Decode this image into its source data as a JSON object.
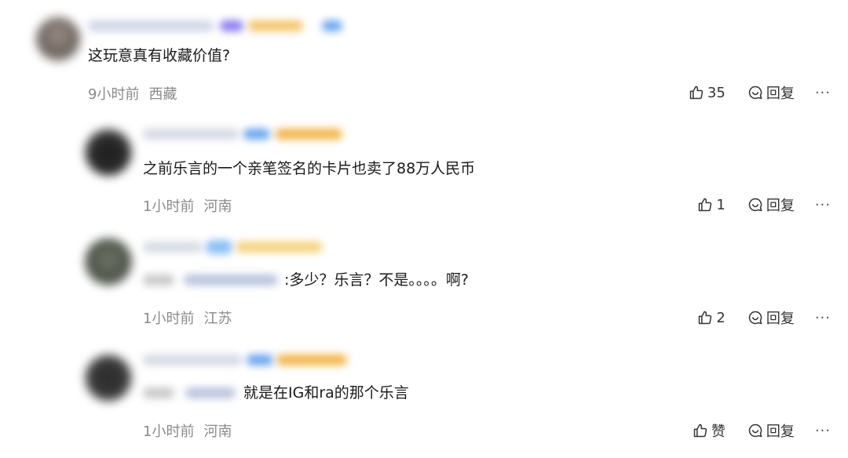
{
  "comments": [
    {
      "text": "这玩意真有收藏价值?",
      "time": "9小时前",
      "location": "西藏",
      "like_label": "35",
      "reply_label": "回复",
      "more_label": "···"
    },
    {
      "text": "之前乐言的一个亲笔签名的卡片也卖了88万人民币",
      "time": "1小时前",
      "location": "河南",
      "like_label": "1",
      "reply_label": "回复",
      "more_label": "···"
    },
    {
      "text": ":多少？乐言？不是。。。。啊?",
      "time": "1小时前",
      "location": "江苏",
      "like_label": "2",
      "reply_label": "回复",
      "more_label": "···"
    },
    {
      "text": "就是在IG和ra的那个乐言",
      "time": "1小时前",
      "location": "河南",
      "like_label": "赞",
      "reply_label": "回复",
      "more_label": "···"
    }
  ],
  "icons": {
    "like": "thumbs-up-icon",
    "reply": "comment-bubble-icon",
    "more": "more-dots-icon"
  },
  "colors": {
    "meta_text": "#8a8a8a",
    "body_text": "#1a1a1a",
    "blur_blue": "#6aa6f0",
    "blur_gold": "#f2b64a",
    "blur_purple": "#8a7cf0"
  }
}
